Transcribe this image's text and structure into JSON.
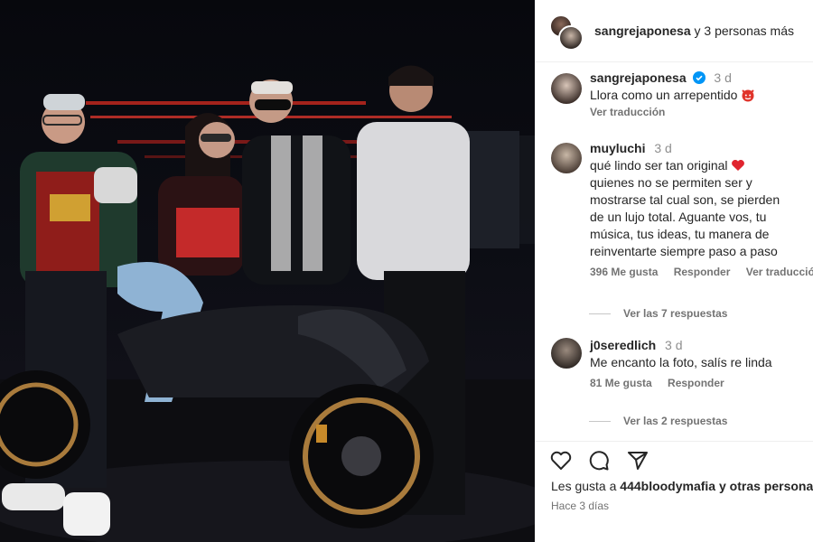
{
  "header": {
    "username": "sangrejaponesa",
    "rest": "y 3 personas más"
  },
  "caption": {
    "username": "sangrejaponesa",
    "time": "3 d",
    "text": "Llora como un arrepentido",
    "translate": "Ver traducción"
  },
  "comments": [
    {
      "username": "muyluchi",
      "time": "3 d",
      "lines": [
        "qué lindo ser tan original",
        "quienes no se permiten ser y",
        "mostrarse tal cual son, se pierden",
        "de un lujo total. Aguante vos, tu",
        "música, tus ideas, tu manera de",
        "reinventarte siempre paso a paso"
      ],
      "likes": "396 Me gusta",
      "reply": "Responder",
      "translate": "Ver traducción",
      "replies": "Ver las 7 respuestas"
    },
    {
      "username": "j0seredlich",
      "time": "3 d",
      "lines": [
        "Me encanto la foto, salís re linda"
      ],
      "likes": "81 Me gusta",
      "reply": "Responder",
      "replies": "Ver las 2 respuestas"
    }
  ],
  "footer": {
    "likes_prefix": "Les gusta a",
    "likes_user": "444bloodymafia",
    "likes_suffix": "y otras personas",
    "date": "Hace 3 días"
  },
  "icons": [
    "heart-icon",
    "comment-icon",
    "share-icon",
    "verified-icon",
    "devil-emoji-icon",
    "heart-emoji-icon"
  ],
  "colors": {
    "verified": "#0095f6",
    "meta": "#737373",
    "text": "#262626"
  }
}
